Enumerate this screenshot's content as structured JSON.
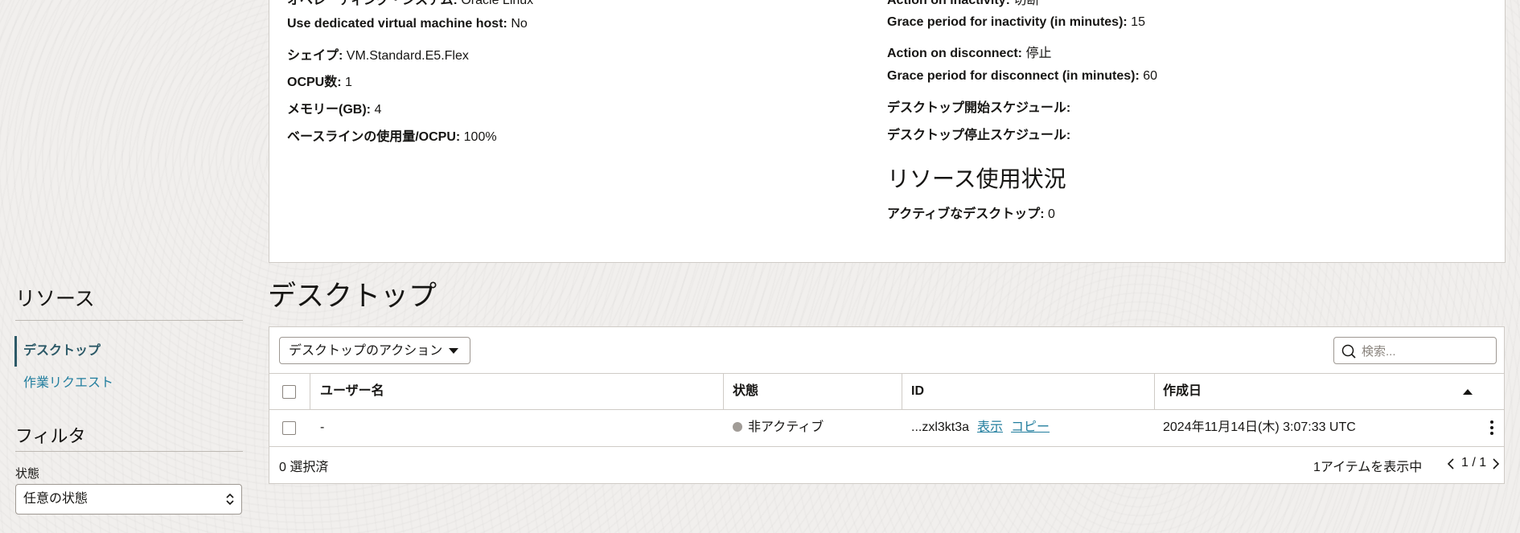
{
  "details": {
    "left": [
      {
        "key": "オペレーティング・システム:",
        "value": "Oracle Linux"
      },
      {
        "key": "Use dedicated virtual machine host:",
        "value": "No"
      },
      {
        "key": "シェイプ:",
        "value": "VM.Standard.E5.Flex"
      },
      {
        "key": "OCPU数:",
        "value": "1"
      },
      {
        "key": "メモリー(GB):",
        "value": "4"
      },
      {
        "key": "ベースラインの使用量/OCPU:",
        "value": "100%"
      }
    ],
    "right": [
      {
        "key": "Action on inactivity:",
        "value": "切断"
      },
      {
        "key": "Grace period for inactivity (in minutes):",
        "value": "15"
      },
      {
        "key": "Action on disconnect:",
        "value": "停止"
      },
      {
        "key": "Grace period for disconnect (in minutes):",
        "value": "60"
      },
      {
        "key": "デスクトップ開始スケジュール:",
        "value": ""
      },
      {
        "key": "デスクトップ停止スケジュール:",
        "value": ""
      }
    ],
    "usage_heading": "リソース使用状況",
    "usage": {
      "key": "アクティブなデスクトップ:",
      "value": "0"
    }
  },
  "resources": {
    "title": "リソース",
    "items": [
      {
        "label": "デスクトップ",
        "active": true
      },
      {
        "label": "作業リクエスト",
        "active": false
      }
    ]
  },
  "filter": {
    "title": "フィルタ",
    "state_label": "状態",
    "state_value": "任意の状態"
  },
  "desktops": {
    "title": "デスクトップ",
    "actions_label": "デスクトップのアクション",
    "search_placeholder": "検索...",
    "columns": [
      "ユーザー名",
      "状態",
      "ID",
      "作成日"
    ],
    "rows": [
      {
        "username": "-",
        "state": "非アクティブ",
        "id": "...zxl3kt3a",
        "id_show": "表示",
        "id_copy": "コピー",
        "created": "2024年11月14日(木) 3:07:33 UTC"
      }
    ],
    "selected_text": "0 選択済",
    "showing_text": "1アイテムを表示中",
    "page_text": "1 / 1"
  },
  "colors": {
    "accent": "#2c5967",
    "link": "#227e9e",
    "inactive_dot": "#a19c97"
  }
}
